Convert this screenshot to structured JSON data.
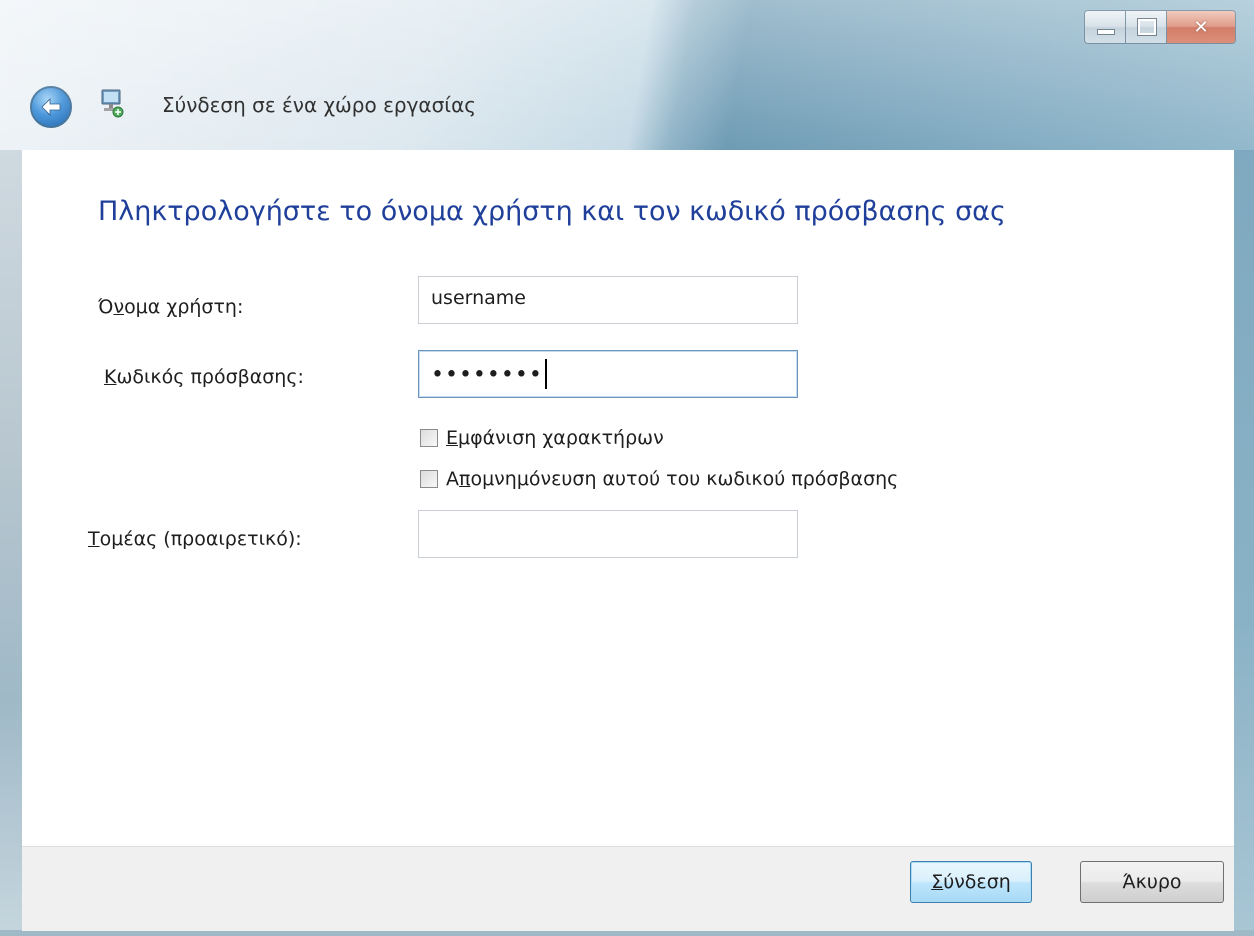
{
  "window": {
    "title": "Σύνδεση σε ένα χώρο εργασίας",
    "caption_buttons": [
      "minimize-icon",
      "maximize-icon",
      "close-icon"
    ]
  },
  "main": {
    "heading": "Πληκτρολογήστε το όνομα χρήστη και τον κωδικό πρόσβασης σας",
    "username": {
      "label_pre": "Ό",
      "label_accel": "ν",
      "label_post": "ομα χρήστη:",
      "value": "username"
    },
    "password": {
      "label_accel": "Κ",
      "label_post": "ωδικός πρόσβασης:",
      "value_masked": "••••••••"
    },
    "show_chars": {
      "label_accel": "Ε",
      "label_post": "μφάνιση χαρακτήρων",
      "checked": false
    },
    "remember": {
      "label_pre": "Α",
      "label_accel": "π",
      "label_post": "ομνημόνευση αυτού του κωδικού πρόσβασης",
      "checked": false
    },
    "domain": {
      "label_accel": "Τ",
      "label_post": "ομέας (προαιρετικό):",
      "value": ""
    }
  },
  "footer": {
    "connect": {
      "label_accel": "Σ",
      "label_post": "ύνδεση"
    },
    "cancel": "Άκυρο"
  },
  "colors": {
    "heading": "#1f3f9a",
    "close_button": "#c04a2e",
    "default_button": "#bee6fd"
  }
}
